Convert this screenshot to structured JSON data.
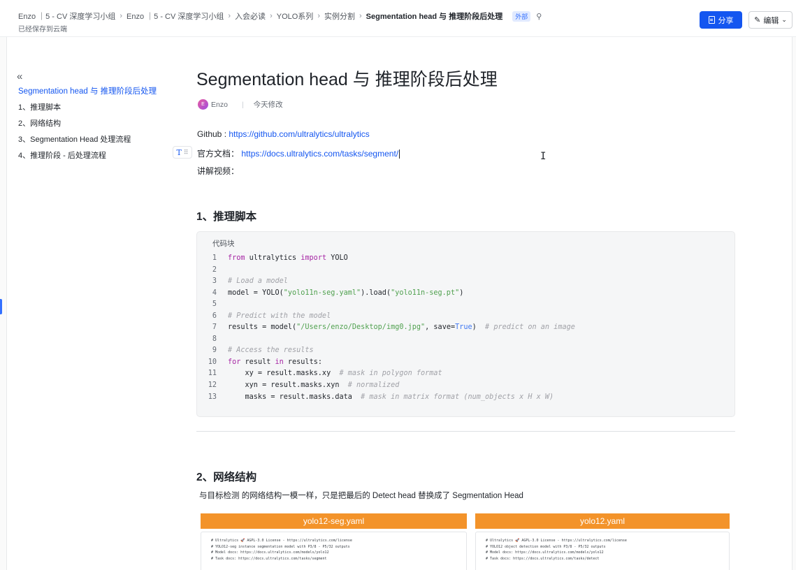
{
  "header": {
    "breadcrumbs": [
      "Enzo ｜5 - CV 深度学习小组",
      "Enzo ｜5 - CV 深度学习小组",
      "入会必读",
      "YOLO系列",
      "实例分割",
      "Segmentation head 与 推理阶段后处理"
    ],
    "external_tag": "外部",
    "saved_status": "已经保存到云端",
    "share_label": "分享",
    "edit_label": "编辑"
  },
  "toc": {
    "items": [
      "Segmentation head 与 推理阶段后处理",
      "1、推理脚本",
      "2、网络结构",
      "3、Segmentation Head 处理流程",
      "4、推理阶段 - 后处理流程"
    ]
  },
  "doc": {
    "title": "Segmentation head 与 推理阶段后处理",
    "author_initial": "E",
    "author": "Enzo",
    "modified": "今天修改",
    "github_label": "Github : ",
    "github_url": "https://github.com/ultralytics/ultralytics",
    "docs_label": "官方文档：",
    "docs_url": "https://docs.ultralytics.com/tasks/segment/",
    "video_label": "讲解视频：",
    "section1": "1、推理脚本",
    "section2": "2、网络结构",
    "section2_desc": "与目标检测 的网络结构一模一样，只是把最后的 Detect head 替换成了 Segmentation Head"
  },
  "code": {
    "label": "代码块",
    "numbers": [
      "1",
      "2",
      "3",
      "4",
      "5",
      "6",
      "7",
      "8",
      "9",
      "10",
      "11",
      "12",
      "13"
    ]
  },
  "images": [
    {
      "title": "yolo12-seg.yaml",
      "lines": [
        "# Ultralytics 🚀 AGPL-3.0 License - https://ultralytics.com/license",
        "",
        "# YOLO12-seg instance segmentation model with P3/8 - P5/32 outputs",
        "# Model docs: https://docs.ultralytics.com/models/yolo12",
        "# Task docs: https://docs.ultralytics.com/tasks/segment"
      ]
    },
    {
      "title": "yolo12.yaml",
      "lines": [
        "# Ultralytics 🚀 AGPL-3.0 License - https://ultralytics.com/license",
        "",
        "# YOLO12 object detection model with P3/8 - P5/32 outputs",
        "# Model docs: https://docs.ultralytics.com/models/yolo12",
        "# Task docs: https://docs.ultralytics.com/tasks/detect"
      ]
    }
  ]
}
